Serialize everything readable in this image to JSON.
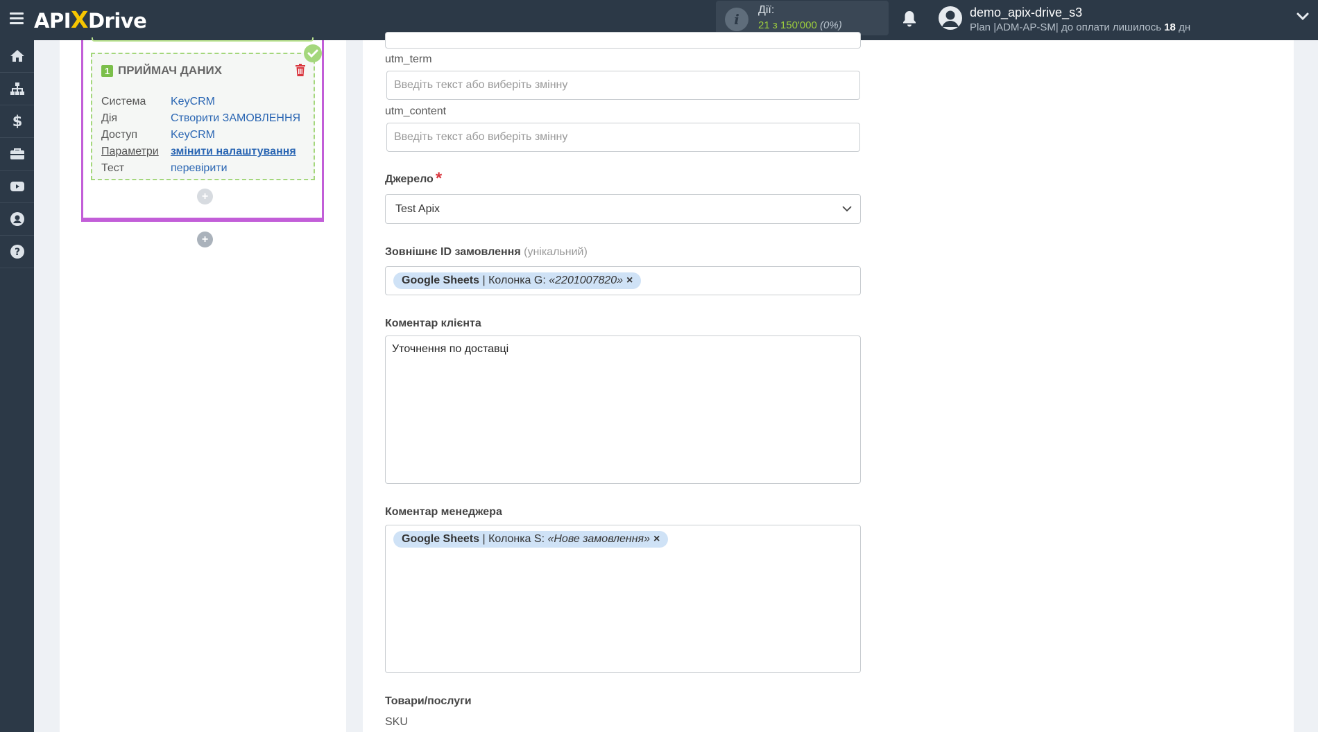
{
  "topbar": {
    "logo_left": "API",
    "logo_x": "X",
    "logo_right": "Drive",
    "actions_label": "Дії:",
    "actions_used": "21",
    "actions_of": "з",
    "actions_total": "150'000",
    "actions_percent": "(0%)",
    "user_name": "demo_apix-drive_s3",
    "plan_prefix": "Plan",
    "plan_code": "|ADM-AP-SM|",
    "plan_suffix": "до оплати лишилось",
    "plan_days": "18",
    "plan_days_unit": "дн"
  },
  "sidebar": {
    "items": [
      {
        "icon": "home-icon"
      },
      {
        "icon": "sitemap-icon"
      },
      {
        "icon": "dollar-icon"
      },
      {
        "icon": "briefcase-icon"
      },
      {
        "icon": "youtube-icon"
      },
      {
        "icon": "user-circle-icon"
      },
      {
        "icon": "help-icon"
      }
    ]
  },
  "receiver_card": {
    "number": "1",
    "title": "ПРИЙМАЧ ДАНИХ",
    "rows": [
      {
        "key": "Система",
        "value": "KeyCRM"
      },
      {
        "key": "Дія",
        "value": "Створити ЗАМОВЛЕННЯ"
      },
      {
        "key": "Доступ",
        "value": "KeyCRM"
      },
      {
        "key": "Параметри",
        "value": "змінити налаштування"
      },
      {
        "key": "Тест",
        "value": "перевірити"
      }
    ],
    "plus": "+"
  },
  "form": {
    "utm_term_label": "utm_term",
    "utm_term_placeholder": "Введіть текст або виберіть змінну",
    "utm_content_label": "utm_content",
    "utm_content_placeholder": "Введіть текст або виберіть змінну",
    "source_label": "Джерело",
    "required_mark": "*",
    "source_value": "Test Apix",
    "external_id_label": "Зовнішнє ID замовлення",
    "external_id_hint": "(унікальний)",
    "external_id_tag": {
      "source": "Google Sheets",
      "column": "| Колонка G:",
      "value": "«2201007820»",
      "remove": "×"
    },
    "client_comment_label": "Коментар клієнта",
    "client_comment_value": "Уточнення по доставці",
    "manager_comment_label": "Коментар менеджера",
    "manager_comment_tag": {
      "source": "Google Sheets",
      "column": "| Колонка S:",
      "value": "«Нове замовлення»",
      "remove": "×"
    },
    "products_label": "Товари/послуги",
    "sku_label": "SKU"
  },
  "colors": {
    "topbar_bg": "#2c3947",
    "accent_green": "#9ccc3d",
    "purple": "#c25ed8",
    "link_blue": "#2a66b3",
    "tag_bg": "#cfe2f6",
    "required_red": "#d9363e"
  }
}
